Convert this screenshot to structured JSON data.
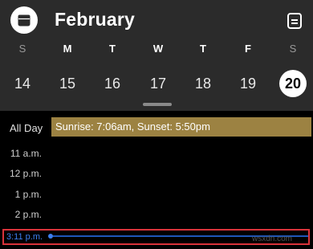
{
  "header": {
    "month": "February",
    "weekdays": [
      {
        "label": "S",
        "weekend": true
      },
      {
        "label": "M",
        "weekend": false
      },
      {
        "label": "T",
        "weekend": false
      },
      {
        "label": "W",
        "weekend": false
      },
      {
        "label": "T",
        "weekend": false
      },
      {
        "label": "F",
        "weekend": false
      },
      {
        "label": "S",
        "weekend": true
      }
    ],
    "days": [
      "14",
      "15",
      "16",
      "17",
      "18",
      "19",
      "20"
    ],
    "selected_day": "20"
  },
  "all_day": {
    "label": "All Day",
    "event": "Sunrise: 7:06am, Sunset: 5:50pm",
    "event_color": "#9c8242"
  },
  "hours": [
    "11 a.m.",
    "12 p.m.",
    "1 p.m.",
    "2 p.m."
  ],
  "now": {
    "time": "3:11 p.m.",
    "color": "#3d7ff0"
  },
  "watermark": "wsxdn.com"
}
